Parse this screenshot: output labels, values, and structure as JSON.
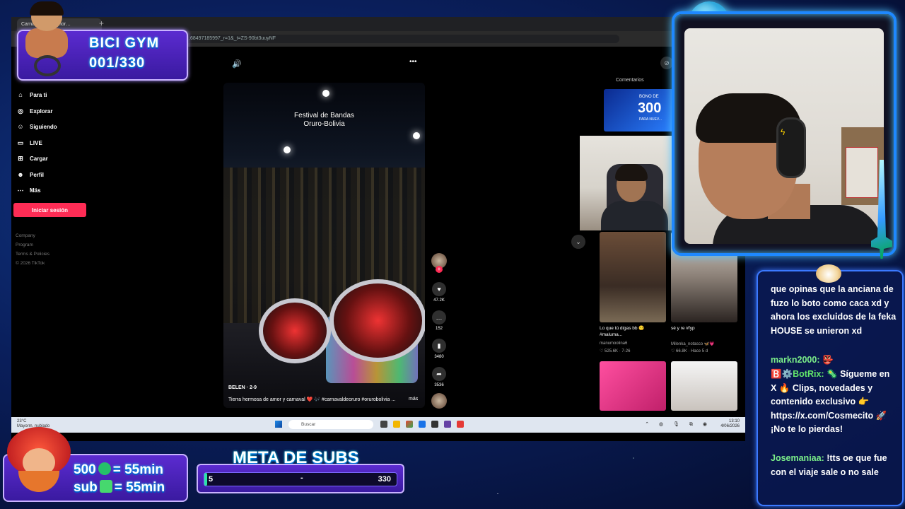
{
  "browser": {
    "tab_title": "Carnaval… de Amor…",
    "url": "…68497185997_r=1&_t=ZS-90bt3uuyNF"
  },
  "sidebar": {
    "items": [
      {
        "icon": "home-icon",
        "label": "Para ti"
      },
      {
        "icon": "compass-icon",
        "label": "Explorar"
      },
      {
        "icon": "following-icon",
        "label": "Siguiendo"
      },
      {
        "icon": "live-icon",
        "label": "LIVE"
      },
      {
        "icon": "upload-icon",
        "label": "Cargar"
      },
      {
        "icon": "profile-icon",
        "label": "Perfil"
      },
      {
        "icon": "more-icon",
        "label": "Más"
      }
    ],
    "login_label": "Iniciar sesión",
    "footer": [
      "Company",
      "Program",
      "Terms & Policies",
      "© 2026 TikTok"
    ]
  },
  "video": {
    "overlay_text": "Festival de Bandas\nOruro-Bolivia",
    "author": "BELEN · 2-9",
    "description": "Tierra hermosa de amor y carnaval ❤️ 🎶 #carnavaldeoruro #orurobolivia ...",
    "more_label": "más",
    "likes": "47.2K",
    "comments": "152",
    "saves": "3480",
    "shares": "3536"
  },
  "comments_panel": {
    "title": "Comentarios",
    "promo": {
      "line1": "BONO DE",
      "line2": "300",
      "line3": "PARA NUEV..."
    }
  },
  "related": [
    {
      "caption": "Lo que tú digas bb 😏 #maluma...",
      "author": "manumoolina6",
      "likes": "525.6K",
      "date": "7-26"
    },
    {
      "caption": "sé y re #fyp",
      "author": "Milenka_notasco 🦋💗",
      "likes": "66.8K",
      "date": "Hace 5 d"
    }
  ],
  "taskbar": {
    "weather": "23°C",
    "weather_sub": "Mayorm. nublado",
    "search_placeholder": "Buscar",
    "time": "13:10",
    "date": "4/06/2026"
  },
  "badge": {
    "title": "BICI GYM",
    "count": "001/330"
  },
  "subs_badge": {
    "line1_amount": "500",
    "line1_rhs": "= 55min",
    "line2_label": "sub",
    "line2_rhs": "= 55min"
  },
  "meta": {
    "title": "META DE SUBS",
    "current": "5",
    "separator": "-",
    "goal": "330",
    "progress": 0.015
  },
  "chat": [
    {
      "user": "",
      "text": "que opinas que la anciana de fuzo lo boto como caca xd y ahora los excluidos de la feka HOUSE se unieron xd"
    },
    {
      "user": "markn2000:",
      "text": "👺"
    },
    {
      "user": "🅱️⚙️BotRix:",
      "text": "🦠 Sígueme en X 🔥 Clips, novedades y contenido exclusivo 👉 https://x.com/Cosmecito 🚀 ¡No te lo pierdas!"
    },
    {
      "user": "Josemaniaa:",
      "text": "!tts oe que fue con el viaje sale o no sale"
    }
  ],
  "colors": {
    "accent": "#fe2c55",
    "frame": "#1e88ff",
    "badge": "#5b2bd0",
    "chat_user": "#7cf08a"
  }
}
